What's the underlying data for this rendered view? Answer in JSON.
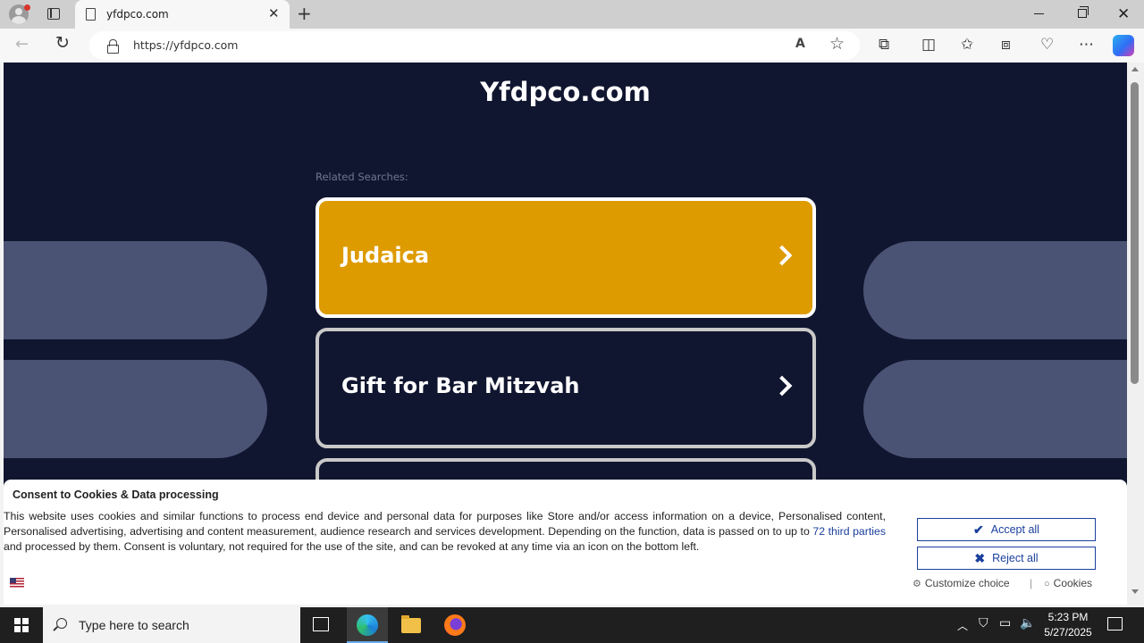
{
  "browser": {
    "tab_title": "yfdpco.com",
    "url": "https://yfdpco.com",
    "new_tab_symbol": "+",
    "close_symbol": "✕"
  },
  "page": {
    "site_title": "Yfdpco.com",
    "related_label": "Related Searches:",
    "cards": [
      {
        "label": "Judaica",
        "highlighted": true
      },
      {
        "label": "Gift for Bar Mitzvah",
        "highlighted": false
      },
      {
        "label": "",
        "highlighted": false
      }
    ],
    "colors": {
      "background": "#111630",
      "highlight": "#dd9b00",
      "pill": "#4b5374"
    }
  },
  "consent": {
    "title": "Consent to Cookies & Data processing",
    "text_before_link": "This website uses cookies and similar functions to process end device and personal data for purposes like Store and/or access information on a device, Personalised content, Personalised advertising, advertising and content measurement, audience research and services development. Depending on the function, data is passed on to up to ",
    "link_text": "72 third parties",
    "text_after_link": " and processed by them. Consent is voluntary, not required for the use of the site, and can be revoked at any time via an icon on the bottom left.",
    "accept_label": "Accept all",
    "reject_label": "Reject all",
    "customize_label": "Customize choice",
    "separator": "|",
    "cookies_label": "Cookies",
    "accent_color": "#1a3f9c"
  },
  "taskbar": {
    "search_placeholder": "Type here to search",
    "time": "5:23 PM",
    "date": "5/27/2025"
  }
}
